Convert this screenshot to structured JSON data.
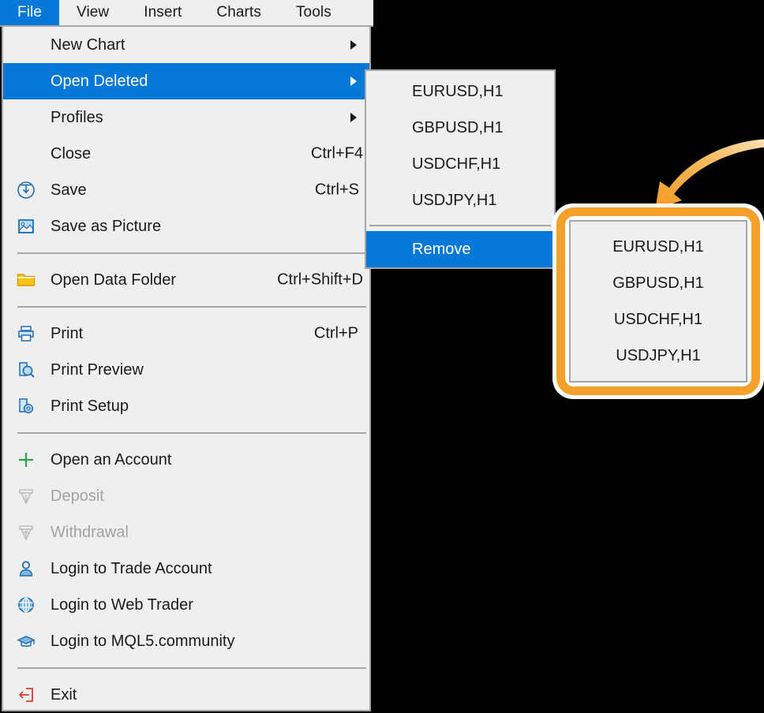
{
  "colors": {
    "accent": "#0678d7",
    "menu_bg": "#efefef",
    "border": "#a6a6a6",
    "callout": "#f4a02a",
    "page_bg": "#000000",
    "disabled_text": "#a2a2a2"
  },
  "menubar": {
    "items": [
      {
        "label": "File",
        "active": true
      },
      {
        "label": "View",
        "active": false
      },
      {
        "label": "Insert",
        "active": false
      },
      {
        "label": "Charts",
        "active": false
      },
      {
        "label": "Tools",
        "active": false
      }
    ]
  },
  "file_menu": {
    "items": [
      {
        "label": "New Chart",
        "accel": "",
        "icon": "none",
        "submenu": true,
        "highlight": false,
        "disabled": false
      },
      {
        "label": "Open Deleted",
        "accel": "",
        "icon": "none",
        "submenu": true,
        "highlight": true,
        "disabled": false
      },
      {
        "label": "Profiles",
        "accel": "",
        "icon": "none",
        "submenu": true,
        "highlight": false,
        "disabled": false
      },
      {
        "label": "Close",
        "accel": "Ctrl+F4",
        "icon": "none",
        "submenu": false,
        "highlight": false,
        "disabled": false
      },
      {
        "label": "Save",
        "accel": "Ctrl+S",
        "icon": "save-icon",
        "submenu": false,
        "highlight": false,
        "disabled": false
      },
      {
        "label": "Save as Picture",
        "accel": "",
        "icon": "picture-icon",
        "submenu": false,
        "highlight": false,
        "disabled": false
      },
      {
        "separator": true
      },
      {
        "label": "Open Data Folder",
        "accel": "Ctrl+Shift+D",
        "icon": "folder-icon",
        "submenu": false,
        "highlight": false,
        "disabled": false
      },
      {
        "separator": true
      },
      {
        "label": "Print",
        "accel": "Ctrl+P",
        "icon": "printer-icon",
        "submenu": false,
        "highlight": false,
        "disabled": false
      },
      {
        "label": "Print Preview",
        "accel": "",
        "icon": "preview-icon",
        "submenu": false,
        "highlight": false,
        "disabled": false
      },
      {
        "label": "Print Setup",
        "accel": "",
        "icon": "setup-icon",
        "submenu": false,
        "highlight": false,
        "disabled": false
      },
      {
        "separator": true
      },
      {
        "label": "Open an Account",
        "accel": "",
        "icon": "plus-icon",
        "submenu": false,
        "highlight": false,
        "disabled": false
      },
      {
        "label": "Deposit",
        "accel": "",
        "icon": "deposit-icon",
        "submenu": false,
        "highlight": false,
        "disabled": true
      },
      {
        "label": "Withdrawal",
        "accel": "",
        "icon": "withdrawal-icon",
        "submenu": false,
        "highlight": false,
        "disabled": true
      },
      {
        "label": "Login to Trade Account",
        "accel": "",
        "icon": "person-icon",
        "submenu": false,
        "highlight": false,
        "disabled": false
      },
      {
        "label": "Login to Web Trader",
        "accel": "",
        "icon": "globe-icon",
        "submenu": false,
        "highlight": false,
        "disabled": false
      },
      {
        "label": "Login to MQL5.community",
        "accel": "",
        "icon": "graduation-icon",
        "submenu": false,
        "highlight": false,
        "disabled": false
      },
      {
        "separator": true
      },
      {
        "label": "Exit",
        "accel": "",
        "icon": "exit-icon",
        "submenu": false,
        "highlight": false,
        "disabled": false
      }
    ]
  },
  "open_deleted_submenu": {
    "items": [
      {
        "label": "EURUSD,H1",
        "highlight": false
      },
      {
        "label": "GBPUSD,H1",
        "highlight": false
      },
      {
        "label": "USDCHF,H1",
        "highlight": false
      },
      {
        "label": "USDJPY,H1",
        "highlight": false
      },
      {
        "separator": true
      },
      {
        "label": "Remove",
        "highlight": true
      }
    ]
  },
  "callout": {
    "items": [
      {
        "label": "EURUSD,H1"
      },
      {
        "label": "GBPUSD,H1"
      },
      {
        "label": "USDCHF,H1"
      },
      {
        "label": "USDJPY,H1"
      }
    ]
  }
}
